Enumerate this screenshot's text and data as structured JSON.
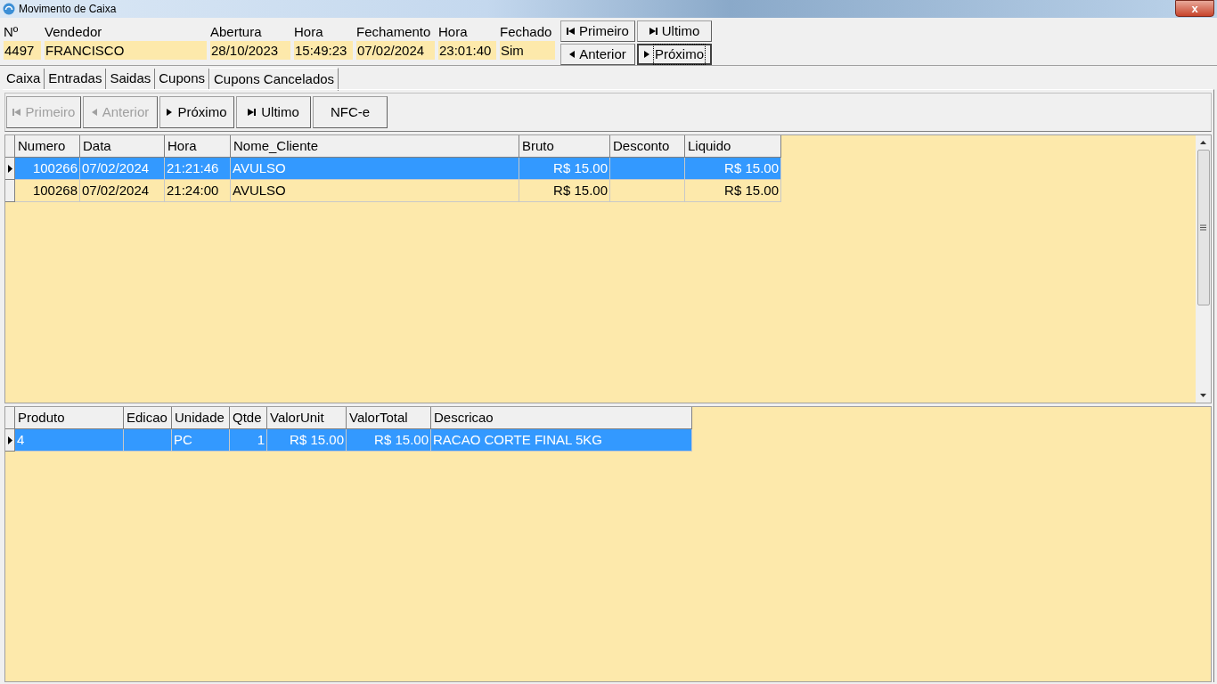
{
  "window": {
    "title": "Movimento de Caixa",
    "close": "x"
  },
  "header_fields": [
    {
      "label": "Nº",
      "value": "4497"
    },
    {
      "label": "Vendedor",
      "value": "FRANCISCO"
    },
    {
      "label": "Abertura",
      "value": "28/10/2023"
    },
    {
      "label": "Hora",
      "value": "15:49:23"
    },
    {
      "label": "Fechamento",
      "value": "07/02/2024"
    },
    {
      "label": "Hora",
      "value": "23:01:40"
    },
    {
      "label": "Fechado",
      "value": "Sim"
    }
  ],
  "header_nav": [
    {
      "kind": "first",
      "label": "Primeiro",
      "focused": false
    },
    {
      "kind": "last",
      "label": "Ultimo",
      "focused": false
    },
    {
      "kind": "prev",
      "label": "Anterior",
      "focused": false
    },
    {
      "kind": "next",
      "label": "Próximo",
      "focused": true
    }
  ],
  "tabs": [
    {
      "label": "Caixa",
      "selected": false
    },
    {
      "label": "Entradas",
      "selected": false
    },
    {
      "label": "Saidas",
      "selected": false
    },
    {
      "label": "Cupons",
      "selected": false
    },
    {
      "label": "Cupons Cancelados",
      "selected": true
    }
  ],
  "toolbar": [
    {
      "kind": "first",
      "label": "Primeiro",
      "disabled": true
    },
    {
      "kind": "prev",
      "label": "Anterior",
      "disabled": true
    },
    {
      "kind": "next",
      "label": "Próximo",
      "disabled": false
    },
    {
      "kind": "last",
      "label": "Ultimo",
      "disabled": false
    },
    {
      "kind": "text",
      "label": "NFC-e",
      "disabled": false
    }
  ],
  "coupons_table": {
    "columns": [
      "Numero",
      "Data",
      "Hora",
      "Nome_Cliente",
      "Bruto",
      "Desconto",
      "Liquido"
    ],
    "rows": [
      {
        "selected": true,
        "cells": [
          "100266",
          "07/02/2024",
          "21:21:46",
          "AVULSO",
          "R$ 15.00",
          "",
          "R$ 15.00"
        ]
      },
      {
        "selected": false,
        "cells": [
          "100268",
          "07/02/2024",
          "21:24:00",
          "AVULSO",
          "R$ 15.00",
          "",
          "R$ 15.00"
        ]
      }
    ]
  },
  "items_table": {
    "columns": [
      "Produto",
      "Edicao",
      "Unidade",
      "Qtde",
      "ValorUnit",
      "ValorTotal",
      "Descricao"
    ],
    "rows": [
      {
        "selected": true,
        "cells": [
          "4",
          "",
          "PC",
          "1",
          "R$ 15.00",
          "R$ 15.00",
          "RACAO CORTE FINAL 5KG"
        ]
      }
    ]
  }
}
